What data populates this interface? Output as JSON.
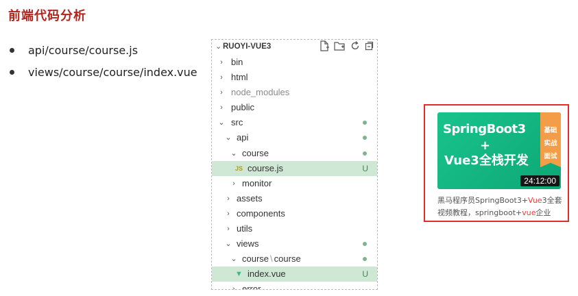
{
  "slide": {
    "title": "前端代码分析",
    "bullets": [
      "api/course/course.js",
      "views/course/course/index.vue"
    ]
  },
  "explorer": {
    "project_name": "RUOYI-VUE3",
    "header_icons": [
      "new-file-icon",
      "new-folder-icon",
      "refresh-icon",
      "collapse-all-icon"
    ],
    "tree": [
      {
        "name": "bin",
        "expanded": false,
        "git": ""
      },
      {
        "name": "html",
        "expanded": false,
        "git": ""
      },
      {
        "name": "node_modules",
        "expanded": false,
        "git": "",
        "dim": true
      },
      {
        "name": "public",
        "expanded": false,
        "git": ""
      },
      {
        "name": "src",
        "expanded": true,
        "git": "dot"
      },
      {
        "name": "api",
        "expanded": true,
        "git": "dot"
      },
      {
        "name": "course",
        "expanded": true,
        "git": "dot"
      },
      {
        "name": "course.js",
        "file_type": "JS",
        "git": "U",
        "selected": true
      },
      {
        "name": "monitor",
        "expanded": false,
        "git": ""
      },
      {
        "name": "assets",
        "expanded": false,
        "git": ""
      },
      {
        "name": "components",
        "expanded": false,
        "git": ""
      },
      {
        "name": "utils",
        "expanded": false,
        "git": ""
      },
      {
        "name": "views",
        "expanded": true,
        "git": "dot"
      },
      {
        "name_parts": [
          "course",
          "course"
        ],
        "expanded": true,
        "git": "dot"
      },
      {
        "name": "index.vue",
        "file_type": "vue",
        "git": "U",
        "selected": true
      },
      {
        "name": "error",
        "expanded": false,
        "git": ""
      }
    ]
  },
  "course_card": {
    "thumb_line1": "SpringBoot3",
    "thumb_line2": "+",
    "thumb_line3": "Vue3全栈开发",
    "ribbon": [
      "基础",
      "实战",
      "面试"
    ],
    "duration": "24:12:00",
    "desc_a": "黑马程序员SpringBoot3+",
    "desc_b": "Vue",
    "desc_c": "3全套视频教程，springboot+",
    "desc_d": "vue",
    "desc_e": "企业"
  }
}
